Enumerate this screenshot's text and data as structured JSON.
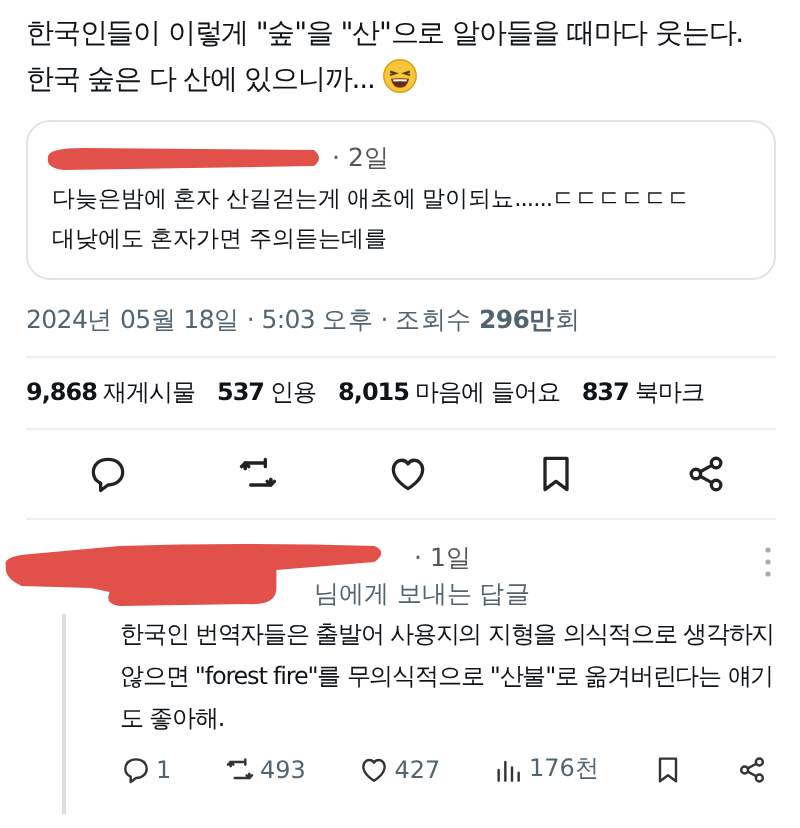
{
  "tweet": {
    "text": "한국인들이 이렇게 \"숲\"을 \"산\"으로 알아들을 때마다 웃는다.\n한국 숲은 다 산에 있으니까...",
    "quote": {
      "time": "· 2일",
      "lines": [
        "다늦은밤에 혼자 산길걷는게 애초에 말이되뇨......ㄷㄷㄷㄷㄷㄷ",
        "대낮에도 혼자가면 주의듣는데를"
      ]
    },
    "timestamp": "2024년 05월 18일 · 5:03 오후 · 조회수 **296만**회",
    "stats": [
      {
        "count": "9,868",
        "label": "재게시물"
      },
      {
        "count": "537",
        "label": "인용"
      },
      {
        "count": "8,015",
        "label": "마음에 들어요"
      },
      {
        "count": "837",
        "label": "북마크"
      }
    ],
    "actions": [
      {
        "kind": "reply"
      },
      {
        "kind": "repost"
      },
      {
        "kind": "like"
      },
      {
        "kind": "bookmark"
      },
      {
        "kind": "share"
      }
    ]
  },
  "reply": {
    "time": "· 1일",
    "replying_to": "님에게 보내는 답글",
    "text": "한국인 번역자들은 출발어 사용지의 지형을 의식적으로 생각하지 않으면 \"forest fire\"를 무의식적으로 \"산불\"로 옮겨버린다는 얘기도 좋아해.",
    "actions": [
      {
        "kind": "reply",
        "count": "1"
      },
      {
        "kind": "repost",
        "count": "493"
      },
      {
        "kind": "like",
        "count": "427"
      },
      {
        "kind": "views",
        "count": "176천"
      },
      {
        "kind": "bookmark"
      },
      {
        "kind": "share"
      }
    ]
  }
}
